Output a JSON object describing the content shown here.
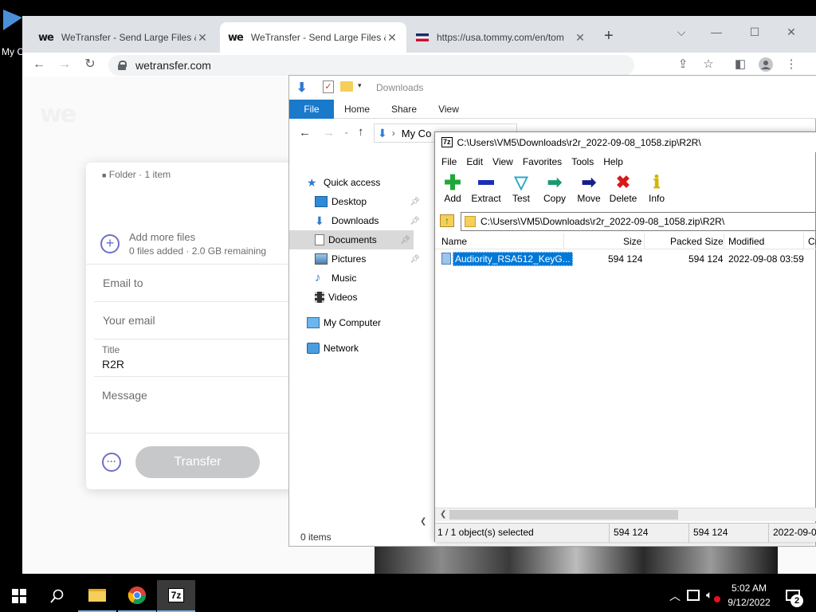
{
  "desktop": {
    "icon_label": "My C"
  },
  "chrome": {
    "tabs": [
      {
        "favicon": "we",
        "title": "WeTransfer - Send Large Files &",
        "close": "✕"
      },
      {
        "favicon": "we",
        "title": "WeTransfer - Send Large Files &",
        "close": "✕"
      },
      {
        "favicon": "flag",
        "title": "https://usa.tommy.com/en/tom",
        "close": "✕"
      }
    ],
    "new_tab": "+",
    "url": "wetransfer.com",
    "window_controls": {
      "dropdown": "⌵",
      "minimize": "—",
      "maximize": "☐",
      "close": "✕"
    }
  },
  "wetransfer": {
    "logo": "we",
    "folder_label": "Folder · 1 item",
    "add_more_files": "Add more files",
    "files_added": "0 files added · 2.0 GB remaining",
    "email_to_placeholder": "Email to",
    "your_email_placeholder": "Your email",
    "title_label": "Title",
    "title_value": "R2R",
    "message_placeholder": "Message",
    "transfer_button": "Transfer",
    "more_options": "···"
  },
  "explorer": {
    "qat_title": "Downloads",
    "ribbon_tabs": [
      "File",
      "Home",
      "Share",
      "View"
    ],
    "breadcrumb": "My Co",
    "nav_items": [
      {
        "label": "Quick access",
        "icon": "star-icon",
        "pinned": false
      },
      {
        "label": "Desktop",
        "icon": "desktop-icon",
        "pinned": true
      },
      {
        "label": "Downloads",
        "icon": "download-icon",
        "pinned": true
      },
      {
        "label": "Documents",
        "icon": "document-icon",
        "pinned": true,
        "selected": true
      },
      {
        "label": "Pictures",
        "icon": "pictures-icon",
        "pinned": true
      },
      {
        "label": "Music",
        "icon": "music-icon",
        "pinned": false
      },
      {
        "label": "Videos",
        "icon": "videos-icon",
        "pinned": false
      },
      {
        "label": "My Computer",
        "icon": "computer-icon",
        "pinned": false
      },
      {
        "label": "Network",
        "icon": "network-icon",
        "pinned": false
      }
    ],
    "status": "0 items"
  },
  "sevenzip": {
    "title": "C:\\Users\\VM5\\Downloads\\r2r_2022-09-08_1058.zip\\R2R\\",
    "menu": [
      "File",
      "Edit",
      "View",
      "Favorites",
      "Tools",
      "Help"
    ],
    "toolbar": [
      {
        "label": "Add",
        "icon": "plus-icon",
        "color": "#1fa83a"
      },
      {
        "label": "Extract",
        "icon": "minus-icon",
        "color": "#1a2fb8"
      },
      {
        "label": "Test",
        "icon": "check-icon",
        "color": "#2aa8c8"
      },
      {
        "label": "Copy",
        "icon": "copy-arrow-icon",
        "color": "#1a9a70"
      },
      {
        "label": "Move",
        "icon": "move-arrow-icon",
        "color": "#141f8a"
      },
      {
        "label": "Delete",
        "icon": "delete-x-icon",
        "color": "#d61a1a"
      },
      {
        "label": "Info",
        "icon": "info-icon",
        "color": "#d4b400"
      }
    ],
    "address": "C:\\Users\\VM5\\Downloads\\r2r_2022-09-08_1058.zip\\R2R\\",
    "columns": [
      "Name",
      "Size",
      "Packed Size",
      "Modified",
      "Cr"
    ],
    "rows": [
      {
        "name": "Audiority_RSA512_KeyG...",
        "size": "594 124",
        "packed": "594 124",
        "modified": "2022-09-08 03:59"
      }
    ],
    "status": {
      "selected": "1 / 1 object(s) selected",
      "size": "594 124",
      "packed": "594 124",
      "modified": "2022-09-0"
    }
  },
  "taskbar": {
    "time": "5:02 AM",
    "date": "9/12/2022",
    "notifications": "2",
    "sevenzip_label": "7z"
  }
}
